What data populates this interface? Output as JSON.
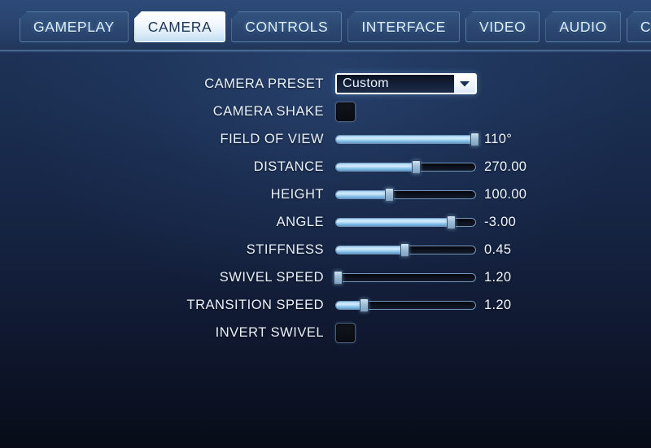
{
  "tabs": [
    {
      "label": "GAMEPLAY",
      "active": false
    },
    {
      "label": "CAMERA",
      "active": true
    },
    {
      "label": "CONTROLS",
      "active": false
    },
    {
      "label": "INTERFACE",
      "active": false
    },
    {
      "label": "VIDEO",
      "active": false
    },
    {
      "label": "AUDIO",
      "active": false
    },
    {
      "label": "CHAT",
      "active": false
    }
  ],
  "settings": [
    {
      "label": "CAMERA PRESET",
      "type": "select",
      "value": "Custom",
      "name": "camera-preset"
    },
    {
      "label": "CAMERA SHAKE",
      "type": "checkbox",
      "checked": false,
      "name": "camera-shake"
    },
    {
      "label": "FIELD OF VIEW",
      "type": "slider",
      "value": "110°",
      "percent": 99,
      "name": "field-of-view"
    },
    {
      "label": "DISTANCE",
      "type": "slider",
      "value": "270.00",
      "percent": 57,
      "name": "distance"
    },
    {
      "label": "HEIGHT",
      "type": "slider",
      "value": "100.00",
      "percent": 38,
      "name": "height"
    },
    {
      "label": "ANGLE",
      "type": "slider",
      "value": "-3.00",
      "percent": 82,
      "name": "angle"
    },
    {
      "label": "STIFFNESS",
      "type": "slider",
      "value": "0.45",
      "percent": 49,
      "name": "stiffness"
    },
    {
      "label": "SWIVEL SPEED",
      "type": "slider",
      "value": "1.20",
      "percent": 2,
      "name": "swivel-speed"
    },
    {
      "label": "TRANSITION SPEED",
      "type": "slider",
      "value": "1.20",
      "percent": 20,
      "name": "transition-speed"
    },
    {
      "label": "INVERT SWIVEL",
      "type": "checkbox",
      "checked": false,
      "name": "invert-swivel"
    }
  ],
  "colors": {
    "selection_highlight": "#f2ef3a",
    "tab_text": "#dff0ff",
    "active_tab_text": "#1d3556",
    "slider_fill": "#9fd2f2",
    "label_text": "#e9f2fb"
  },
  "icons": {
    "chevron_down": "chevron-down-icon",
    "dropdown_arrow": "dropdown-arrow-icon"
  }
}
